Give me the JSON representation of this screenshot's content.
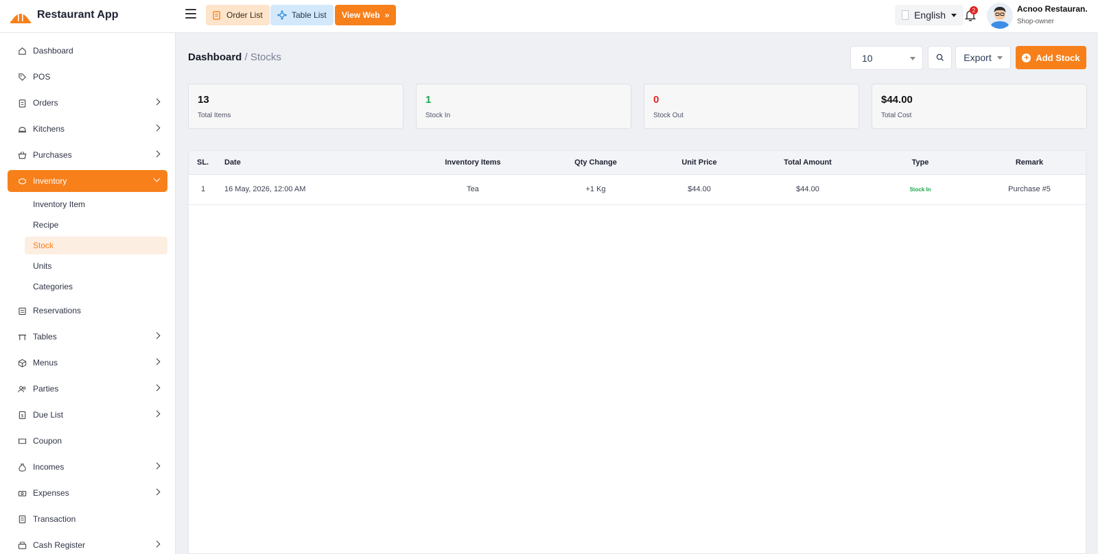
{
  "app": {
    "name": "Restaurant App"
  },
  "topbar": {
    "order_list": "Order List",
    "table_list": "Table List",
    "view_web": "View Web",
    "language": "English",
    "notification_count": "2",
    "user_name": "Acnoo Restauran.",
    "user_role": "Shop-owner"
  },
  "sidebar": {
    "items": [
      {
        "label": "Dashboard",
        "icon": "home-icon"
      },
      {
        "label": "POS",
        "icon": "tag-icon"
      },
      {
        "label": "Orders",
        "icon": "clipboard-icon"
      },
      {
        "label": "Kitchens",
        "icon": "cloche-icon"
      },
      {
        "label": "Purchases",
        "icon": "basket-icon"
      },
      {
        "label": "Inventory",
        "icon": "box-icon"
      },
      {
        "label": "Reservations",
        "icon": "calendar-icon"
      },
      {
        "label": "Tables",
        "icon": "table-icon"
      },
      {
        "label": "Menus",
        "icon": "cube-icon"
      },
      {
        "label": "Parties",
        "icon": "users-icon"
      },
      {
        "label": "Due List",
        "icon": "receipt-icon"
      },
      {
        "label": "Coupon",
        "icon": "ticket-icon"
      },
      {
        "label": "Incomes",
        "icon": "money-bag-icon"
      },
      {
        "label": "Expenses",
        "icon": "cash-icon"
      },
      {
        "label": "Transaction",
        "icon": "ledger-icon"
      },
      {
        "label": "Cash Register",
        "icon": "register-icon"
      }
    ],
    "inventory_sub": [
      "Inventory Item",
      "Recipe",
      "Stock",
      "Units",
      "Categories"
    ]
  },
  "breadcrumb": {
    "root": "Dashboard",
    "current": "/ Stocks"
  },
  "toolbar": {
    "page_size": "10",
    "export": "Export",
    "add": "Add Stock"
  },
  "stats": [
    {
      "value": "13",
      "label": "Total Items"
    },
    {
      "value": "1",
      "label": "Stock In"
    },
    {
      "value": "0",
      "label": "Stock Out"
    },
    {
      "value": "$44.00",
      "label": "Total Cost"
    }
  ],
  "table": {
    "headers": [
      "SL.",
      "Date",
      "Inventory Items",
      "Qty Change",
      "Unit Price",
      "Total Amount",
      "Type",
      "Remark"
    ],
    "rows": [
      {
        "sl": "1",
        "date": "16 May, 2026, 12:00 AM",
        "item": "Tea",
        "qty": "+1 Kg",
        "unit_price": "$44.00",
        "total": "$44.00",
        "type": "Stock In",
        "remark": "Purchase #5"
      }
    ]
  },
  "colors": {
    "accent": "#f7801b",
    "stock_in": "#1ba94c",
    "stock_out": "#e02424"
  }
}
